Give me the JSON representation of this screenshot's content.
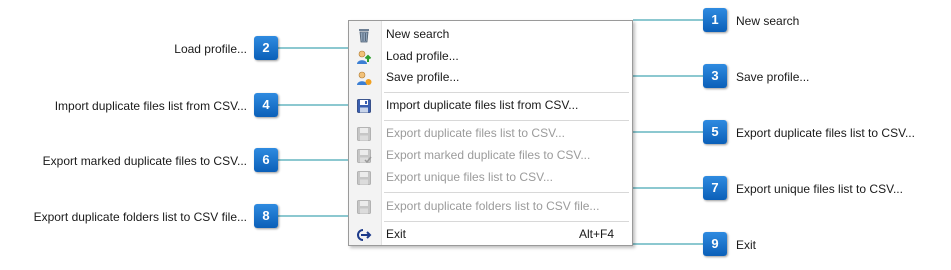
{
  "menu": {
    "items": [
      {
        "label": "New search",
        "icon": "recycle-bin-icon",
        "enabled": true
      },
      {
        "label": "Load profile...",
        "icon": "user-load-icon",
        "enabled": true
      },
      {
        "label": "Save profile...",
        "icon": "user-save-icon",
        "enabled": true
      },
      {
        "label": "Import duplicate files list from CSV...",
        "icon": "floppy-disk-icon",
        "enabled": true
      },
      {
        "label": "Export duplicate files list to CSV...",
        "icon": "floppy-disk-icon",
        "enabled": false
      },
      {
        "label": "Export marked duplicate files to CSV...",
        "icon": "floppy-disk-icon",
        "enabled": false
      },
      {
        "label": "Export unique files list to CSV...",
        "icon": "floppy-disk-icon",
        "enabled": false
      },
      {
        "label": "Export duplicate folders list to CSV file...",
        "icon": "floppy-disk-icon",
        "enabled": false
      },
      {
        "label": "Exit",
        "icon": "exit-arrow-icon",
        "enabled": true,
        "shortcut": "Alt+F4"
      }
    ]
  },
  "callouts": [
    {
      "number": "1",
      "text": "New search"
    },
    {
      "number": "2",
      "text": "Load profile..."
    },
    {
      "number": "3",
      "text": "Save profile..."
    },
    {
      "number": "4",
      "text": "Import duplicate files list from CSV..."
    },
    {
      "number": "5",
      "text": "Export duplicate files list to CSV..."
    },
    {
      "number": "6",
      "text": "Export marked duplicate files to CSV..."
    },
    {
      "number": "7",
      "text": "Export unique files list to CSV..."
    },
    {
      "number": "8",
      "text": "Export duplicate folders list to CSV file..."
    },
    {
      "number": "9",
      "text": "Exit"
    }
  ],
  "colors": {
    "badge": "#1a74d0",
    "connector": "#1a90a0",
    "disabled_text": "#9b9b9b"
  }
}
